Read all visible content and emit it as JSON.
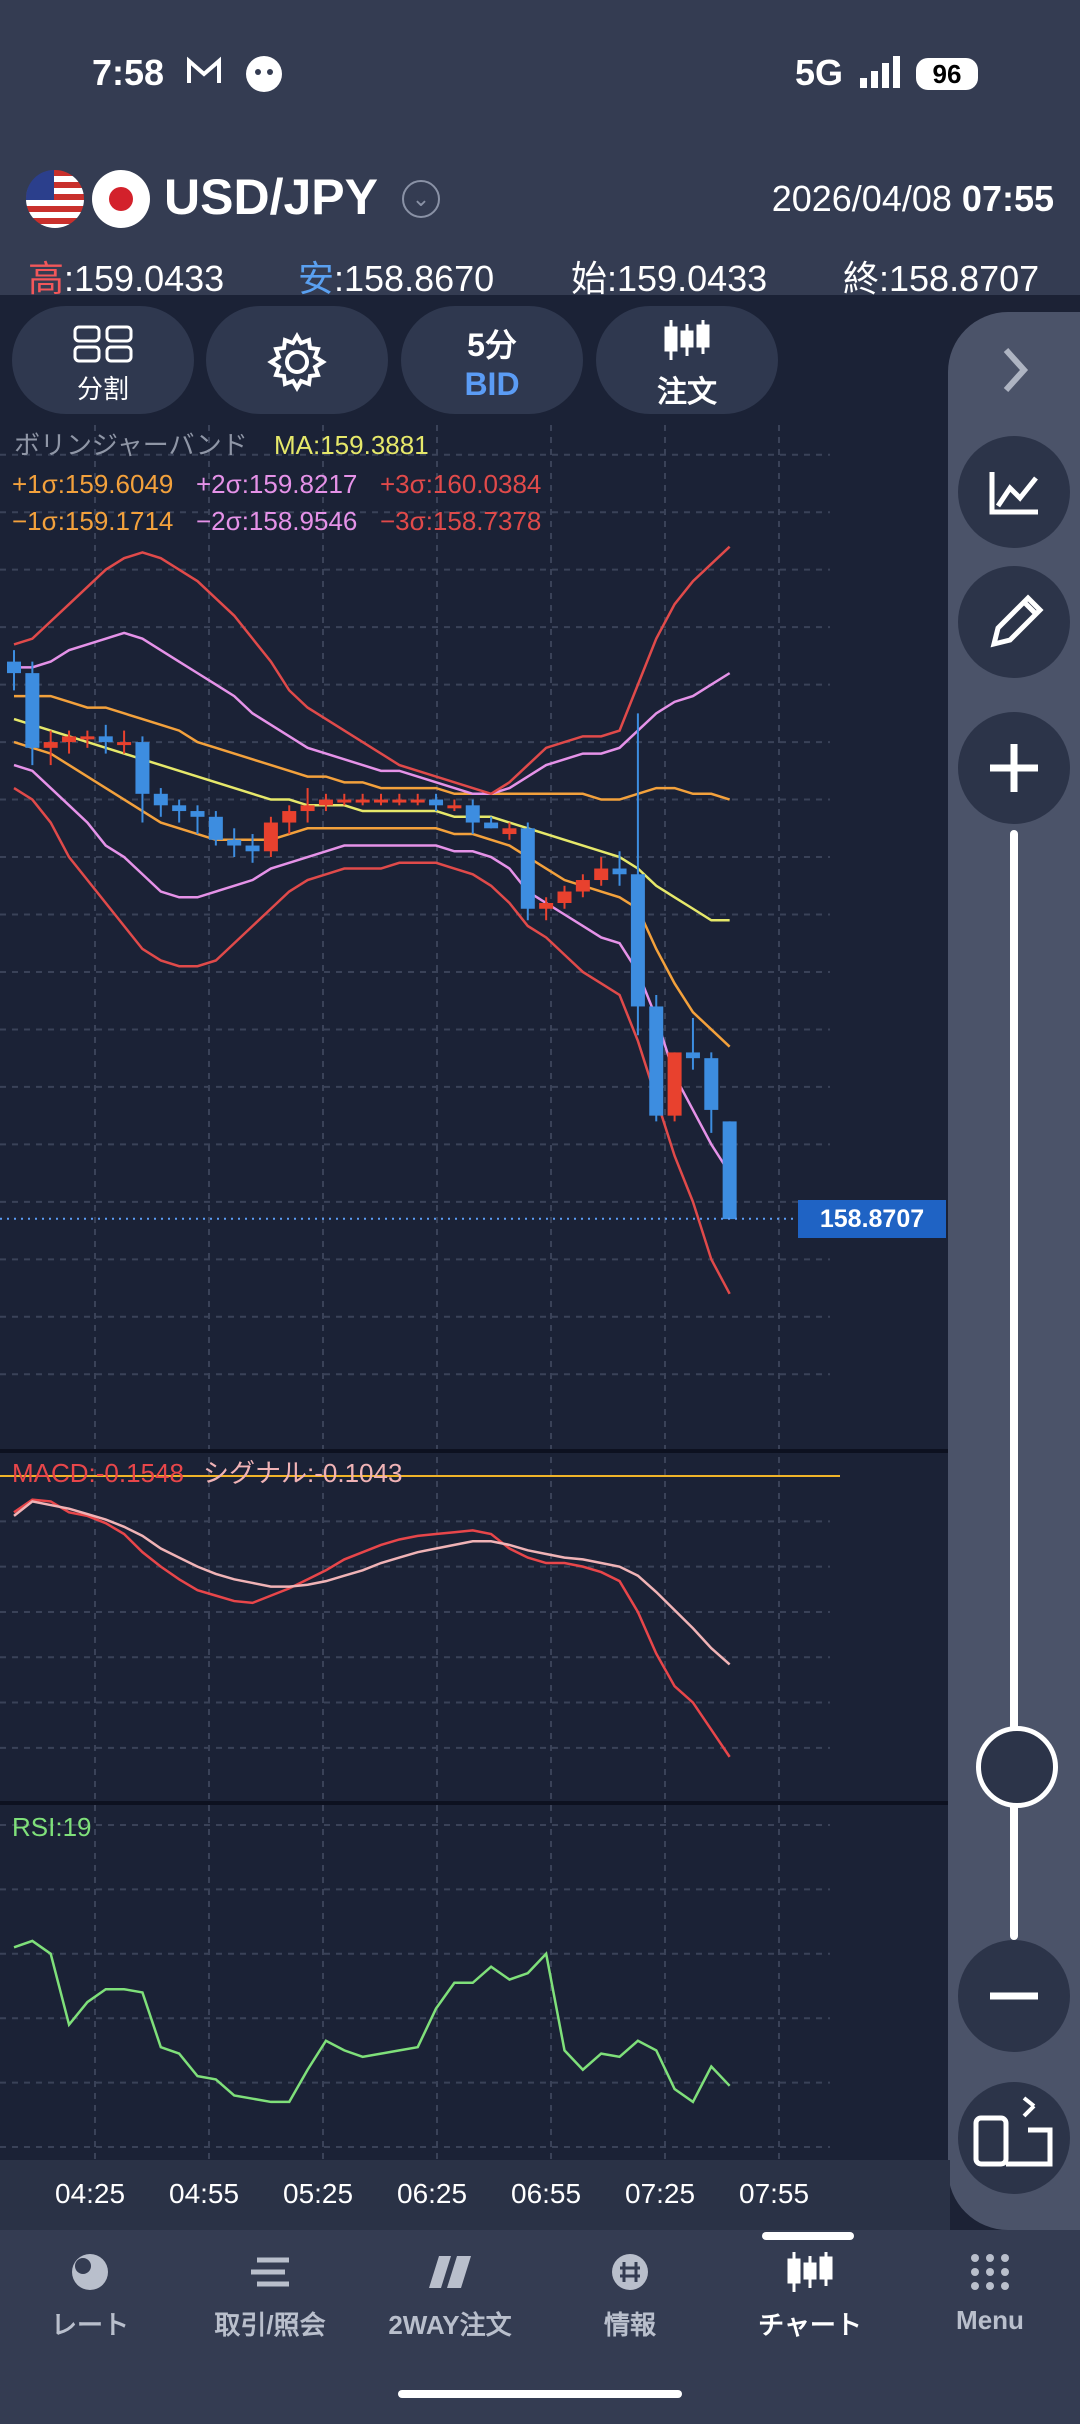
{
  "status_bar": {
    "time": "7:58",
    "network": "5G",
    "battery": "96",
    "icons": [
      "mail-icon",
      "notification-icon",
      "signal-icon",
      "battery-icon"
    ]
  },
  "header": {
    "pair": "USD/JPY",
    "date": "2026/04/08",
    "time": "07:55",
    "ohlc": [
      {
        "key": "高",
        "value": ":159.0433"
      },
      {
        "key": "安",
        "value": ":158.8670"
      },
      {
        "key": "始",
        "value": ":159.0433"
      },
      {
        "key": "終",
        "value": ":158.8707"
      }
    ]
  },
  "toolbar": {
    "split_label": "分割",
    "interval_label": "5分",
    "price_type": "BID",
    "order_label": "注文"
  },
  "indicators": {
    "bollinger_title": "ボリンジャーバンド",
    "ma": "MA:159.3881",
    "plus1": "+1σ:159.6049",
    "plus2": "+2σ:159.8217",
    "plus3": "+3σ:160.0384",
    "minus1": "−1σ:159.1714",
    "minus2": "−2σ:158.9546",
    "minus3": "−3σ:158.7378",
    "macd": "MACD:-0.1548",
    "signal": "シグナル:-0.1043",
    "rsi": "RSI:19"
  },
  "current_price": "158.8707",
  "colors": {
    "up": "#e8412e",
    "down": "#3d8de0",
    "ma": "#e6e86a",
    "sigma1": "#f3a13c",
    "sigma2": "#e592e8",
    "sigma3": "#e04a4a",
    "macd": "#e8464a",
    "signal": "#f0b3b6",
    "rsi": "#7fe07a",
    "background": "#1b2236",
    "accent": "#5b9cf5"
  },
  "chart_data": [
    {
      "type": "candlestick",
      "title": "USD/JPY",
      "x": [
        "04:25",
        "04:55",
        "05:25",
        "06:25",
        "06:55",
        "07:25",
        "07:55"
      ],
      "ylim": [
        158.55,
        160.25
      ],
      "yticks": [
        "160.2000",
        "160.1000",
        "160.0000",
        "159.9000",
        "159.8000",
        "159.7000",
        "159.6000",
        "159.5000",
        "159.4000",
        "159.3000",
        "159.2000",
        "159.1000",
        "159.0000",
        "158.9000",
        "158.8000",
        "158.7000",
        "158.6000"
      ],
      "candles": [
        {
          "o": 159.84,
          "h": 159.86,
          "l": 159.79,
          "c": 159.82
        },
        {
          "o": 159.82,
          "h": 159.84,
          "l": 159.66,
          "c": 159.69
        },
        {
          "o": 159.69,
          "h": 159.72,
          "l": 159.66,
          "c": 159.7
        },
        {
          "o": 159.7,
          "h": 159.72,
          "l": 159.68,
          "c": 159.71
        },
        {
          "o": 159.71,
          "h": 159.72,
          "l": 159.69,
          "c": 159.71
        },
        {
          "o": 159.71,
          "h": 159.73,
          "l": 159.68,
          "c": 159.7
        },
        {
          "o": 159.7,
          "h": 159.72,
          "l": 159.68,
          "c": 159.7
        },
        {
          "o": 159.7,
          "h": 159.71,
          "l": 159.56,
          "c": 159.61
        },
        {
          "o": 159.61,
          "h": 159.62,
          "l": 159.57,
          "c": 159.59
        },
        {
          "o": 159.59,
          "h": 159.6,
          "l": 159.56,
          "c": 159.58
        },
        {
          "o": 159.58,
          "h": 159.59,
          "l": 159.54,
          "c": 159.57
        },
        {
          "o": 159.57,
          "h": 159.58,
          "l": 159.52,
          "c": 159.53
        },
        {
          "o": 159.53,
          "h": 159.55,
          "l": 159.5,
          "c": 159.52
        },
        {
          "o": 159.52,
          "h": 159.54,
          "l": 159.49,
          "c": 159.51
        },
        {
          "o": 159.51,
          "h": 159.57,
          "l": 159.5,
          "c": 159.56
        },
        {
          "o": 159.56,
          "h": 159.59,
          "l": 159.54,
          "c": 159.58
        },
        {
          "o": 159.58,
          "h": 159.62,
          "l": 159.56,
          "c": 159.59
        },
        {
          "o": 159.59,
          "h": 159.61,
          "l": 159.58,
          "c": 159.6
        },
        {
          "o": 159.6,
          "h": 159.61,
          "l": 159.59,
          "c": 159.6
        },
        {
          "o": 159.6,
          "h": 159.61,
          "l": 159.59,
          "c": 159.6
        },
        {
          "o": 159.6,
          "h": 159.61,
          "l": 159.59,
          "c": 159.6
        },
        {
          "o": 159.6,
          "h": 159.61,
          "l": 159.59,
          "c": 159.6
        },
        {
          "o": 159.6,
          "h": 159.61,
          "l": 159.59,
          "c": 159.6
        },
        {
          "o": 159.6,
          "h": 159.61,
          "l": 159.58,
          "c": 159.59
        },
        {
          "o": 159.59,
          "h": 159.6,
          "l": 159.58,
          "c": 159.59
        },
        {
          "o": 159.59,
          "h": 159.6,
          "l": 159.54,
          "c": 159.56
        },
        {
          "o": 159.56,
          "h": 159.57,
          "l": 159.55,
          "c": 159.55
        },
        {
          "o": 159.54,
          "h": 159.56,
          "l": 159.53,
          "c": 159.55
        },
        {
          "o": 159.55,
          "h": 159.56,
          "l": 159.39,
          "c": 159.41
        },
        {
          "o": 159.41,
          "h": 159.43,
          "l": 159.39,
          "c": 159.42
        },
        {
          "o": 159.42,
          "h": 159.45,
          "l": 159.41,
          "c": 159.44
        },
        {
          "o": 159.44,
          "h": 159.47,
          "l": 159.43,
          "c": 159.46
        },
        {
          "o": 159.46,
          "h": 159.5,
          "l": 159.45,
          "c": 159.48
        },
        {
          "o": 159.48,
          "h": 159.51,
          "l": 159.45,
          "c": 159.47
        },
        {
          "o": 159.47,
          "h": 159.75,
          "l": 159.19,
          "c": 159.24
        },
        {
          "o": 159.24,
          "h": 159.26,
          "l": 159.04,
          "c": 159.05
        },
        {
          "o": 159.05,
          "h": 159.16,
          "l": 159.04,
          "c": 159.16
        },
        {
          "o": 159.16,
          "h": 159.22,
          "l": 159.13,
          "c": 159.15
        },
        {
          "o": 159.15,
          "h": 159.16,
          "l": 159.02,
          "c": 159.06
        },
        {
          "o": 159.04,
          "h": 159.04,
          "l": 158.87,
          "c": 158.87
        }
      ],
      "series": [
        {
          "name": "MA",
          "values": [
            159.74,
            159.73,
            159.72,
            159.71,
            159.7,
            159.69,
            159.68,
            159.67,
            159.66,
            159.65,
            159.64,
            159.63,
            159.62,
            159.61,
            159.6,
            159.6,
            159.59,
            159.59,
            159.59,
            159.58,
            159.58,
            159.58,
            159.58,
            159.58,
            159.57,
            159.57,
            159.57,
            159.56,
            159.55,
            159.54,
            159.53,
            159.52,
            159.51,
            159.5,
            159.48,
            159.45,
            159.43,
            159.41,
            159.39,
            159.39
          ]
        },
        {
          "name": "+1σ",
          "values": [
            159.78,
            159.78,
            159.78,
            159.77,
            159.76,
            159.76,
            159.75,
            159.74,
            159.73,
            159.72,
            159.7,
            159.69,
            159.68,
            159.67,
            159.66,
            159.65,
            159.64,
            159.64,
            159.63,
            159.63,
            159.62,
            159.62,
            159.62,
            159.62,
            159.61,
            159.61,
            159.61,
            159.61,
            159.61,
            159.61,
            159.61,
            159.61,
            159.6,
            159.6,
            159.61,
            159.62,
            159.62,
            159.61,
            159.61,
            159.6
          ]
        },
        {
          "name": "+2σ",
          "values": [
            159.83,
            159.83,
            159.84,
            159.86,
            159.87,
            159.88,
            159.89,
            159.88,
            159.86,
            159.84,
            159.82,
            159.8,
            159.78,
            159.75,
            159.73,
            159.71,
            159.69,
            159.68,
            159.67,
            159.66,
            159.65,
            159.65,
            159.64,
            159.63,
            159.62,
            159.61,
            159.61,
            159.62,
            159.64,
            159.66,
            159.67,
            159.68,
            159.68,
            159.69,
            159.72,
            159.75,
            159.77,
            159.78,
            159.8,
            159.82
          ]
        },
        {
          "name": "+3σ",
          "values": [
            159.87,
            159.88,
            159.91,
            159.94,
            159.97,
            160.0,
            160.02,
            160.03,
            160.02,
            160.0,
            159.98,
            159.95,
            159.92,
            159.88,
            159.84,
            159.79,
            159.76,
            159.74,
            159.72,
            159.7,
            159.68,
            159.66,
            159.65,
            159.64,
            159.63,
            159.62,
            159.61,
            159.63,
            159.66,
            159.69,
            159.7,
            159.71,
            159.71,
            159.72,
            159.8,
            159.88,
            159.94,
            159.98,
            160.01,
            160.04
          ]
        },
        {
          "name": "−1σ",
          "values": [
            159.7,
            159.69,
            159.68,
            159.66,
            159.64,
            159.62,
            159.6,
            159.58,
            159.56,
            159.55,
            159.54,
            159.53,
            159.53,
            159.53,
            159.53,
            159.54,
            159.55,
            159.55,
            159.55,
            159.55,
            159.55,
            159.55,
            159.55,
            159.55,
            159.54,
            159.54,
            159.53,
            159.52,
            159.5,
            159.48,
            159.46,
            159.45,
            159.44,
            159.43,
            159.41,
            159.34,
            159.28,
            159.23,
            159.2,
            159.17
          ]
        },
        {
          "name": "−2σ",
          "values": [
            159.66,
            159.65,
            159.62,
            159.59,
            159.56,
            159.52,
            159.5,
            159.47,
            159.44,
            159.43,
            159.43,
            159.44,
            159.45,
            159.46,
            159.48,
            159.49,
            159.5,
            159.51,
            159.52,
            159.52,
            159.52,
            159.52,
            159.52,
            159.52,
            159.51,
            159.51,
            159.5,
            159.48,
            159.44,
            159.42,
            159.4,
            159.38,
            159.36,
            159.35,
            159.3,
            159.22,
            159.12,
            159.06,
            159.0,
            158.95
          ]
        },
        {
          "name": "−3σ",
          "values": [
            159.62,
            159.6,
            159.56,
            159.5,
            159.46,
            159.42,
            159.38,
            159.34,
            159.32,
            159.31,
            159.31,
            159.32,
            159.35,
            159.38,
            159.41,
            159.44,
            159.46,
            159.47,
            159.48,
            159.48,
            159.48,
            159.49,
            159.49,
            159.49,
            159.48,
            159.47,
            159.45,
            159.42,
            159.38,
            159.36,
            159.33,
            159.3,
            159.28,
            159.26,
            159.18,
            159.08,
            158.98,
            158.9,
            158.8,
            158.74
          ]
        }
      ]
    },
    {
      "type": "line",
      "title": "MACD",
      "ylim": [
        -0.165,
        0.005
      ],
      "yticks": [
        "0.0000",
        "-0.0250",
        "-0.0500",
        "-0.0750",
        "-0.1000",
        "-0.1250",
        "-0.1500"
      ],
      "series": [
        {
          "name": "MACD",
          "values": [
            -0.02,
            -0.013,
            -0.014,
            -0.02,
            -0.022,
            -0.026,
            -0.032,
            -0.042,
            -0.05,
            -0.057,
            -0.063,
            -0.066,
            -0.069,
            -0.07,
            -0.066,
            -0.062,
            -0.057,
            -0.052,
            -0.046,
            -0.042,
            -0.038,
            -0.035,
            -0.033,
            -0.032,
            -0.031,
            -0.03,
            -0.032,
            -0.04,
            -0.045,
            -0.048,
            -0.048,
            -0.05,
            -0.053,
            -0.058,
            -0.075,
            -0.098,
            -0.116,
            -0.125,
            -0.14,
            -0.155
          ]
        },
        {
          "name": "シグナル",
          "values": [
            -0.022,
            -0.014,
            -0.016,
            -0.018,
            -0.021,
            -0.024,
            -0.028,
            -0.033,
            -0.04,
            -0.045,
            -0.05,
            -0.054,
            -0.057,
            -0.059,
            -0.061,
            -0.061,
            -0.06,
            -0.058,
            -0.055,
            -0.052,
            -0.048,
            -0.045,
            -0.042,
            -0.04,
            -0.038,
            -0.036,
            -0.036,
            -0.038,
            -0.041,
            -0.043,
            -0.045,
            -0.046,
            -0.048,
            -0.05,
            -0.055,
            -0.064,
            -0.074,
            -0.084,
            -0.095,
            -0.104
          ]
        }
      ]
    },
    {
      "type": "line",
      "title": "RSI",
      "ylim": [
        0,
        100
      ],
      "yticks": [
        "100",
        "80",
        "60",
        "40",
        "20",
        "0"
      ],
      "series": [
        {
          "name": "RSI",
          "values": [
            62,
            64,
            60,
            38,
            45,
            49,
            49,
            48,
            31,
            29,
            22,
            21,
            16,
            15,
            14,
            14,
            24,
            33,
            30,
            28,
            29,
            30,
            31,
            43,
            51,
            51,
            56,
            52,
            54,
            60,
            30,
            24,
            29,
            28,
            33,
            30,
            18,
            14,
            25,
            19
          ]
        }
      ]
    }
  ],
  "chart_x_labels": [
    "04:25",
    "04:55",
    "05:25",
    "06:25",
    "06:55",
    "07:25",
    "07:55"
  ],
  "bottom_nav": [
    {
      "label": "レート",
      "icon": "rate-icon"
    },
    {
      "label": "取引/照会",
      "icon": "trade-icon"
    },
    {
      "label": "2WAY注文",
      "icon": "twoway-icon"
    },
    {
      "label": "情報",
      "icon": "info-icon"
    },
    {
      "label": "チャート",
      "icon": "chart-icon"
    },
    {
      "label": "Menu",
      "icon": "menu-grid-icon"
    }
  ]
}
